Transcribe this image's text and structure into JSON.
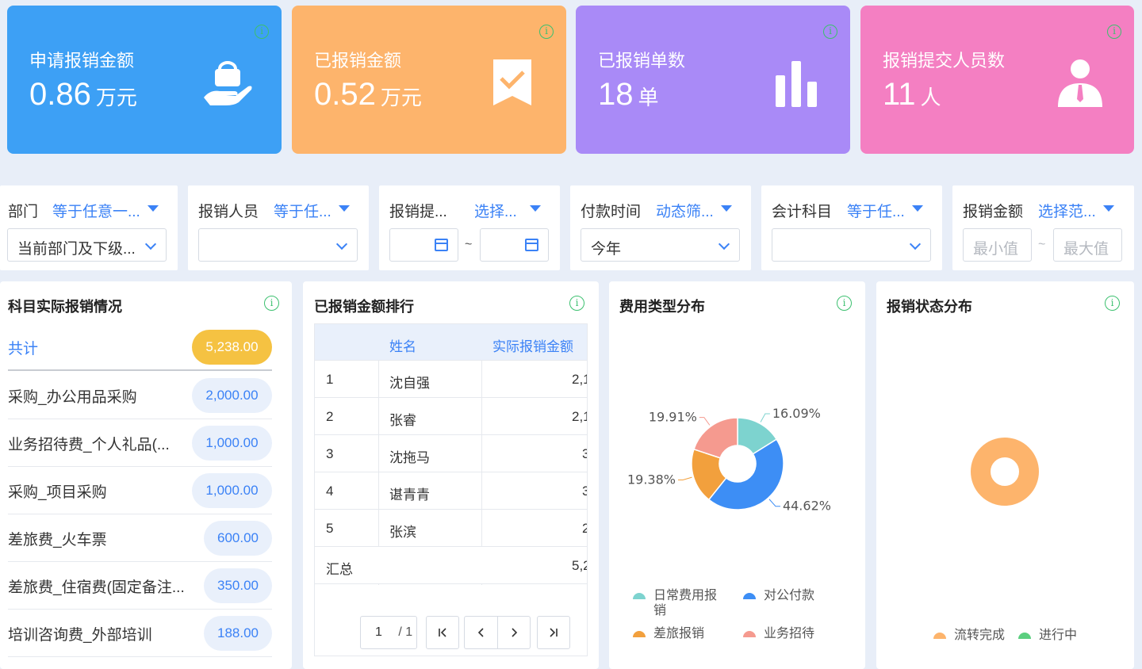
{
  "kpis": [
    {
      "label": "申请报销金额",
      "value": "0.86",
      "unit": "万元",
      "color": "#3da0f5",
      "icon": "hand-bag-icon"
    },
    {
      "label": "已报销金额",
      "value": "0.52",
      "unit": "万元",
      "color": "#fdb46c",
      "icon": "bookmark-check-icon"
    },
    {
      "label": "已报销单数",
      "value": "18",
      "unit": "单",
      "color": "#a98af7",
      "icon": "bar-chart-icon"
    },
    {
      "label": "报销提交人员数",
      "value": "11",
      "unit": "人",
      "color": "#f47fc2",
      "icon": "person-tie-icon"
    }
  ],
  "filters": {
    "dept": {
      "label": "部门",
      "op": "等于任意一...",
      "value": "当前部门及下级..."
    },
    "person": {
      "label": "报销人员",
      "op": "等于任...",
      "value": ""
    },
    "submit": {
      "label": "报销提...",
      "op": "选择...",
      "sep": "~"
    },
    "paytime": {
      "label": "付款时间",
      "op": "动态筛...",
      "value": "今年"
    },
    "account": {
      "label": "会计科目",
      "op": "等于任...",
      "value": ""
    },
    "amount": {
      "label": "报销金额",
      "op": "选择范...",
      "min_ph": "最小值",
      "sep": "~",
      "max_ph": "最大值"
    }
  },
  "subjects": {
    "title": "科目实际报销情况",
    "total_label": "共计",
    "total_value": "5,238.00",
    "rows": [
      {
        "name": "采购_办公用品采购",
        "value": "2,000.00"
      },
      {
        "name": "业务招待费_个人礼品(...",
        "value": "1,000.00"
      },
      {
        "name": "采购_项目采购",
        "value": "1,000.00"
      },
      {
        "name": "差旅费_火车票",
        "value": "600.00"
      },
      {
        "name": "差旅费_住宿费(固定备注...",
        "value": "350.00"
      },
      {
        "name": "培训咨询费_外部培训",
        "value": "188.00"
      }
    ]
  },
  "ranking": {
    "title": "已报销金额排行",
    "col_name": "姓名",
    "col_amount": "实际报销金额",
    "rows": [
      {
        "rank": "1",
        "name": "沈自强",
        "amount": "2,1"
      },
      {
        "rank": "2",
        "name": "张睿",
        "amount": "2,1"
      },
      {
        "rank": "3",
        "name": "沈拖马",
        "amount": "3"
      },
      {
        "rank": "4",
        "name": "谌青青",
        "amount": "3"
      },
      {
        "rank": "5",
        "name": "张滨",
        "amount": "2"
      }
    ],
    "total_label": "汇总",
    "total_amount": "5,2",
    "page": "1",
    "page_total": "/ 1"
  },
  "expense_type": {
    "title": "费用类型分布",
    "legend": [
      {
        "name": "日常费用报销",
        "color": "#7dd3cf"
      },
      {
        "name": "对公付款",
        "color": "#3d8ef5"
      },
      {
        "name": "差旅报销",
        "color": "#f2a03d"
      },
      {
        "name": "业务招待",
        "color": "#f59a8f"
      }
    ]
  },
  "status": {
    "title": "报销状态分布",
    "legend": [
      {
        "name": "流转完成",
        "color": "#fdb46c"
      },
      {
        "name": "进行中",
        "color": "#5bcf7f"
      }
    ]
  },
  "chart_data": [
    {
      "type": "pie",
      "title": "费用类型分布",
      "categories": [
        "日常费用报销",
        "对公付款",
        "差旅报销",
        "业务招待"
      ],
      "values": [
        16.09,
        44.62,
        19.38,
        19.91
      ],
      "labels": [
        "16.09%",
        "44.62%",
        "19.38%",
        "19.91%"
      ],
      "colors": [
        "#7dd3cf",
        "#3d8ef5",
        "#f2a03d",
        "#f59a8f"
      ],
      "legend": "bottom"
    },
    {
      "type": "pie",
      "title": "报销状态分布",
      "categories": [
        "流转完成",
        "进行中"
      ],
      "values": [
        100,
        0
      ],
      "colors": [
        "#fdb46c",
        "#5bcf7f"
      ],
      "legend": "bottom"
    }
  ]
}
